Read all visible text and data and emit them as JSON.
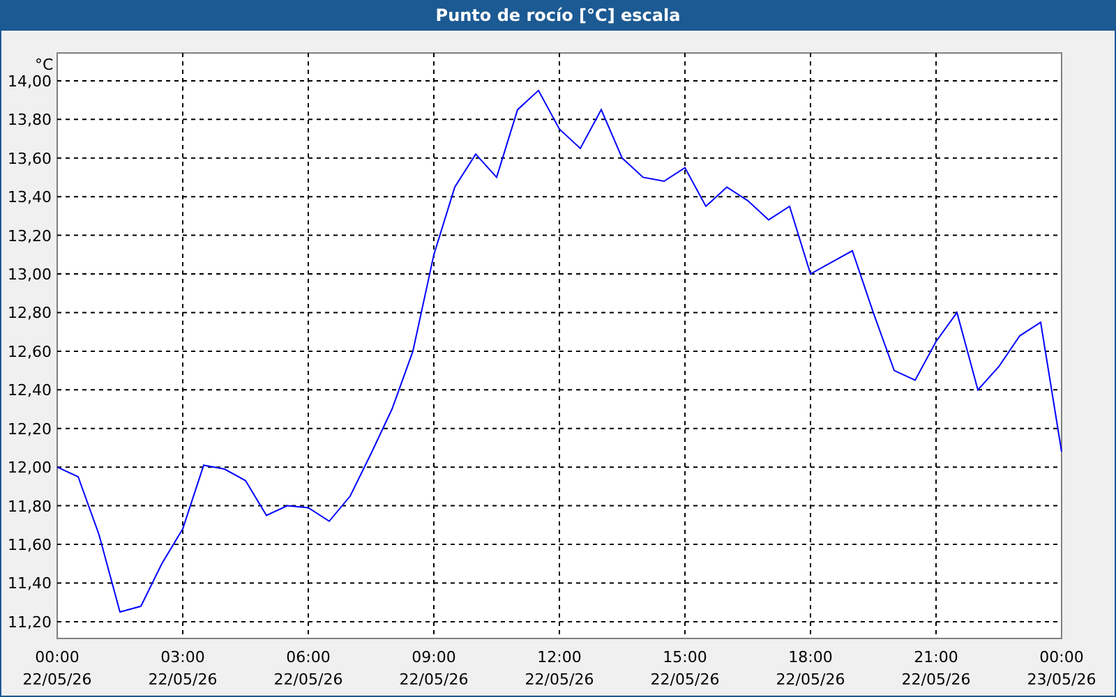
{
  "window": {
    "title": "Punto de rocío [°C] escala"
  },
  "chart": {
    "chart_data": {
      "type": "line",
      "ylabel": "°C",
      "categories": [
        "00:00\n22/05/26",
        null,
        null,
        null,
        null,
        null,
        "03:00\n22/05/26",
        null,
        null,
        null,
        null,
        null,
        "06:00\n22/05/26",
        null,
        null,
        null,
        null,
        null,
        "09:00\n22/05/26",
        null,
        null,
        null,
        null,
        null,
        "12:00\n22/05/26",
        null,
        null,
        null,
        null,
        null,
        "15:00\n22/05/26",
        null,
        null,
        null,
        null,
        null,
        "18:00\n22/05/26",
        null,
        null,
        null,
        null,
        null,
        "21:00\n22/05/26",
        null,
        null,
        null,
        null,
        null,
        "00:00\n23/05/26"
      ],
      "series": [
        {
          "color": "#0000ff",
          "values": [
            12.0,
            11.95,
            11.65,
            11.25,
            11.28,
            11.5,
            11.68,
            12.01,
            11.99,
            11.93,
            11.75,
            11.8,
            11.79,
            11.72,
            11.85,
            12.07,
            12.3,
            12.6,
            13.1,
            13.45,
            13.62,
            13.5,
            13.85,
            13.95,
            13.75,
            13.65,
            13.85,
            13.6,
            13.5,
            13.48,
            13.55,
            13.35,
            13.45,
            13.38,
            13.28,
            13.35,
            13.0,
            13.06,
            13.12,
            12.8,
            12.5,
            12.45,
            12.65,
            12.8,
            12.4,
            12.52,
            12.68,
            12.75,
            12.08
          ]
        }
      ],
      "ylim": [
        11.113,
        14.144
      ],
      "grid": true,
      "yticks": [
        {
          "value": 11.2,
          "label": "11,20"
        },
        {
          "value": 11.4,
          "label": "11,40"
        },
        {
          "value": 11.6,
          "label": "11,60"
        },
        {
          "value": 11.8,
          "label": "11,80"
        },
        {
          "value": 12.0,
          "label": "12,00"
        },
        {
          "value": 12.2,
          "label": "12,20"
        },
        {
          "value": 12.4,
          "label": "12,40"
        },
        {
          "value": 12.6,
          "label": "12,60"
        },
        {
          "value": 12.8,
          "label": "12,80"
        },
        {
          "value": 13.0,
          "label": "13,00"
        },
        {
          "value": 13.2,
          "label": "13,20"
        },
        {
          "value": 13.4,
          "label": "13,40"
        },
        {
          "value": 13.6,
          "label": "13,60"
        },
        {
          "value": 13.8,
          "label": "13,80"
        },
        {
          "value": 14.0,
          "label": "14,00"
        }
      ]
    }
  }
}
